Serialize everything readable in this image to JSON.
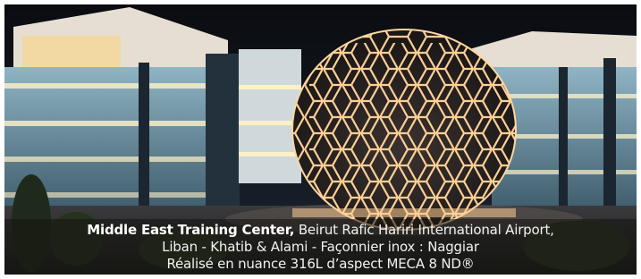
{
  "photo": {
    "subject": "Middle East Training Center building with illuminated geodesic hexagonal dome at night"
  },
  "caption": {
    "name": "Middle East Training Center,",
    "location": " Beirut Rafic Hariri International Airport,",
    "line2": "Liban - Khatib & Alami - Façonnier inox : Naggiar",
    "line3": "Réalisé en nuance 316L d’aspect MECA 8 ND®"
  },
  "colors": {
    "sky": "#0d1117",
    "glow": "#ffd9a8",
    "dome": "#2a2626",
    "glass": "#7fa3b6"
  }
}
